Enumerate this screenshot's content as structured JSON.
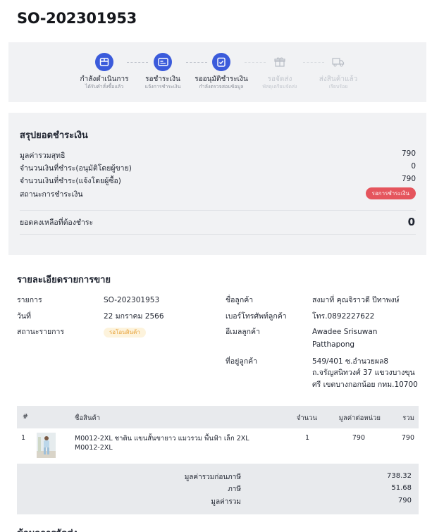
{
  "order": {
    "number": "SO-202301953"
  },
  "steps": [
    {
      "label": "กำลังดำเนินการ",
      "sub": "ได้รับคำสั่งซื้อแล้ว",
      "icon": "box-icon",
      "state": "active"
    },
    {
      "label": "รอชำระเงิน",
      "sub": "แจ้งการชำระเงิน",
      "icon": "credit-card-icon",
      "state": "active"
    },
    {
      "label": "รออนุมัติชำระเงิน",
      "sub": "กำลังตรวจสอบข้อมูล",
      "icon": "clipboard-check-icon",
      "state": "active"
    },
    {
      "label": "รอจัดส่ง",
      "sub": "พัสดุเตรียมจัดส่ง",
      "icon": "gift-box-icon",
      "state": "inactive"
    },
    {
      "label": "ส่งสินค้าแล้ว",
      "sub": "เรียบร้อย",
      "icon": "truck-icon",
      "state": "inactive"
    }
  ],
  "payment": {
    "title": "สรุปยอดชำระเงิน",
    "net_label": "มูลค่ารวมสุทธิ",
    "net_value": "790",
    "paid_approved_label": "จำนวนเงินที่ชำระ(อนุมัติโดยผู้ขาย)",
    "paid_approved_value": "0",
    "paid_notified_label": "จำนวนเงินที่ชำระ(แจ้งโดยผู้ซื้อ)",
    "paid_notified_value": "790",
    "status_label": "สถานะการชำระเงิน",
    "status_value": "รอการชำระเงิน",
    "balance_label": "ยอดคงเหลือที่ต้องชำระ",
    "balance_value": "0"
  },
  "detail": {
    "title": "รายละเอียดรายการขาย",
    "item_label": "รายการ",
    "item_value": "SO-202301953",
    "date_label": "วันที่",
    "date_value": "22 มกราคม 2566",
    "status_label": "สถานะรายการ",
    "status_value": "รอโอนสินค้า",
    "customer_label": "ชื่อลูกค้า",
    "customer_value": "สงมาที่ คุณจิราวดี ปีทาพงษ์",
    "phone_label": "เบอร์โทรศัพท์ลูกค้า",
    "phone_value": "โทร.0892227622",
    "email_label": "อีเมลลูกค้า",
    "email_value_1": "Awadee Srisuwan",
    "email_value_2": "Patthapong",
    "address_label": "ที่อยู่ลูกค้า",
    "address_1": "549/401 ซ.อำนวยผล8",
    "address_2": "ถ.จรัญสนิทวงศ์ 37 แขวงบางขุน",
    "address_3": "ศรี เขตบางกอกน้อย กทม.10700"
  },
  "table": {
    "headers": {
      "num": "#",
      "name": "ชื่อสินค้า",
      "qty": "จำนวน",
      "unit": "มูลค่าต่อหน่วย",
      "total": "รวม"
    },
    "rows": [
      {
        "num": "1",
        "name_1": "M0012-2XL ชาติน แขนสั้นขายาว แมวรวม พื้นฟ้า เล็ก 2XL",
        "name_2": "M0012-2XL",
        "qty": "1",
        "unit": "790",
        "total": "790"
      }
    ]
  },
  "totals": {
    "pretax_label": "มูลค่ารวมก่อนภาษี",
    "pretax_value": "738.32",
    "tax_label": "ภาษี",
    "tax_value": "51.68",
    "total_label": "มูลค่ารวม",
    "total_value": "790"
  },
  "next_section": {
    "title": "ข้อมูลการจัดส่ง"
  },
  "colors": {
    "accent": "#3b5bdb",
    "status_red": "#e5555d",
    "badge_bg": "#fdf3dc",
    "badge_text": "#e7a23a"
  }
}
